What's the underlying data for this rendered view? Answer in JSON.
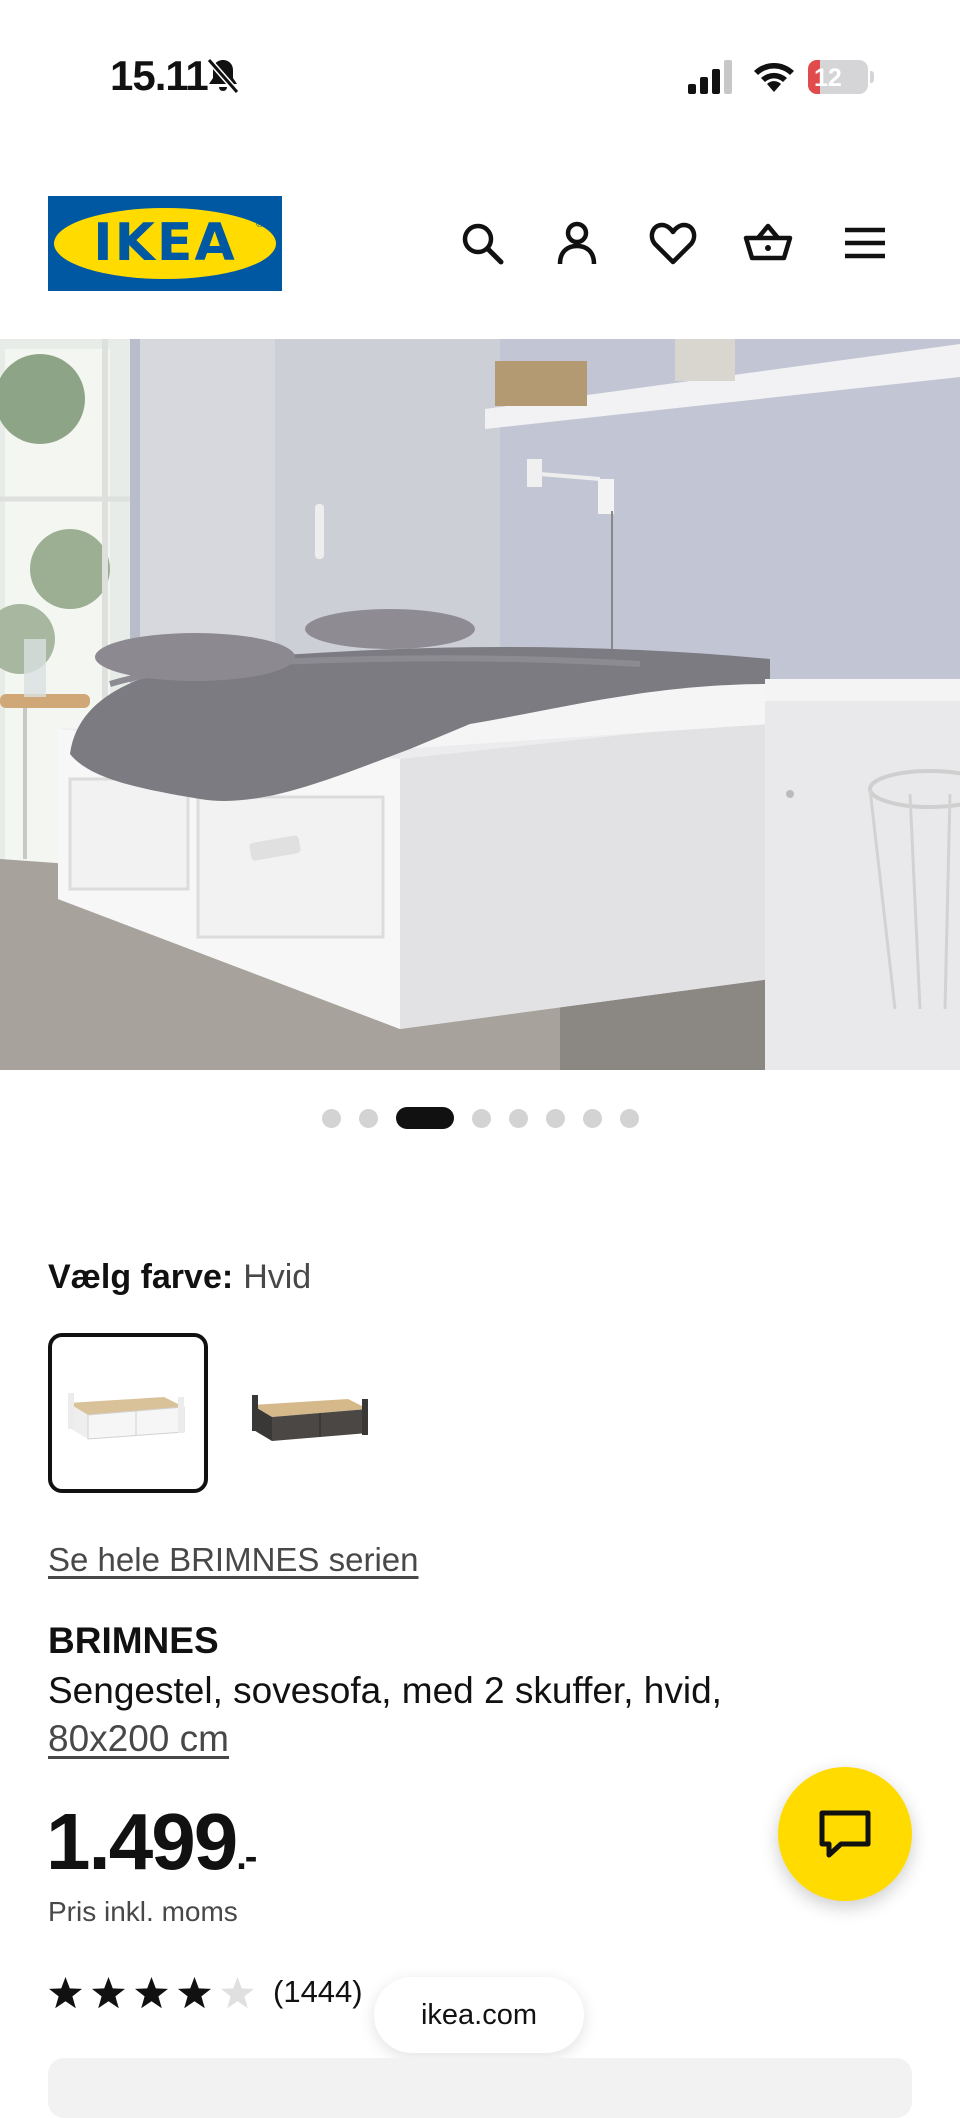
{
  "status_bar": {
    "time": "15.11",
    "battery_level": "12"
  },
  "header": {
    "logo_text": "IKEA",
    "icons": [
      "search-icon",
      "account-icon",
      "heart-icon",
      "basket-icon",
      "menu-icon"
    ]
  },
  "gallery": {
    "image_count": 8,
    "active_index": 2
  },
  "color": {
    "label": "Vælg farve:",
    "value": "Hvid",
    "options": [
      "white",
      "black-brown"
    ]
  },
  "product": {
    "series_link": "Se hele BRIMNES serien",
    "name": "BRIMNES",
    "description": "Sengestel, sovesofa, med 2 skuffer, hvid,",
    "size": "80x200 cm",
    "price": "1.499",
    "price_suffix": ".-",
    "price_note": "Pris inkl. moms",
    "rating": 4,
    "rating_max": 5,
    "review_count": "(1444)"
  },
  "browser": {
    "url": "ikea.com"
  },
  "colors": {
    "ikea_blue": "#0058a3",
    "ikea_yellow": "#ffdb00"
  }
}
